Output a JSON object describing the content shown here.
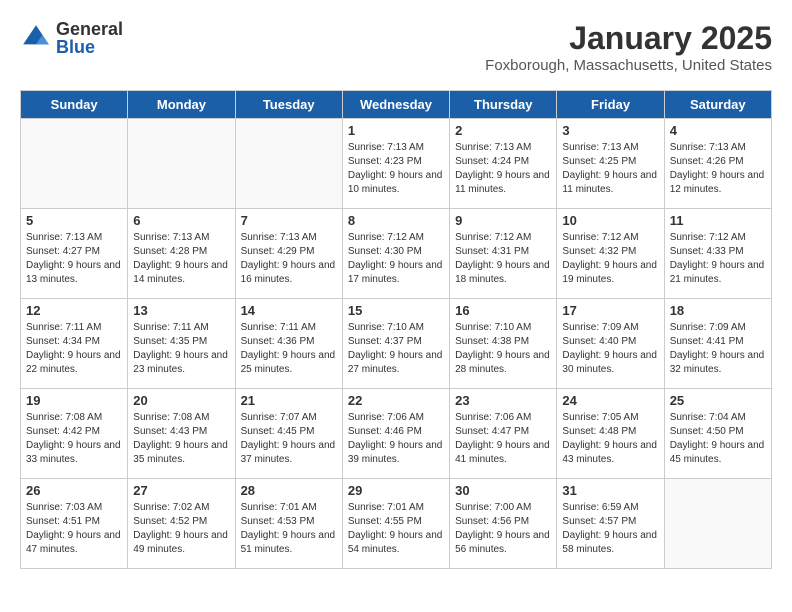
{
  "header": {
    "logo_general": "General",
    "logo_blue": "Blue",
    "month_title": "January 2025",
    "location": "Foxborough, Massachusetts, United States"
  },
  "weekdays": [
    "Sunday",
    "Monday",
    "Tuesday",
    "Wednesday",
    "Thursday",
    "Friday",
    "Saturday"
  ],
  "weeks": [
    [
      {
        "day": "",
        "sunrise": "",
        "sunset": "",
        "daylight": ""
      },
      {
        "day": "",
        "sunrise": "",
        "sunset": "",
        "daylight": ""
      },
      {
        "day": "",
        "sunrise": "",
        "sunset": "",
        "daylight": ""
      },
      {
        "day": "1",
        "sunrise": "Sunrise: 7:13 AM",
        "sunset": "Sunset: 4:23 PM",
        "daylight": "Daylight: 9 hours and 10 minutes."
      },
      {
        "day": "2",
        "sunrise": "Sunrise: 7:13 AM",
        "sunset": "Sunset: 4:24 PM",
        "daylight": "Daylight: 9 hours and 11 minutes."
      },
      {
        "day": "3",
        "sunrise": "Sunrise: 7:13 AM",
        "sunset": "Sunset: 4:25 PM",
        "daylight": "Daylight: 9 hours and 11 minutes."
      },
      {
        "day": "4",
        "sunrise": "Sunrise: 7:13 AM",
        "sunset": "Sunset: 4:26 PM",
        "daylight": "Daylight: 9 hours and 12 minutes."
      }
    ],
    [
      {
        "day": "5",
        "sunrise": "Sunrise: 7:13 AM",
        "sunset": "Sunset: 4:27 PM",
        "daylight": "Daylight: 9 hours and 13 minutes."
      },
      {
        "day": "6",
        "sunrise": "Sunrise: 7:13 AM",
        "sunset": "Sunset: 4:28 PM",
        "daylight": "Daylight: 9 hours and 14 minutes."
      },
      {
        "day": "7",
        "sunrise": "Sunrise: 7:13 AM",
        "sunset": "Sunset: 4:29 PM",
        "daylight": "Daylight: 9 hours and 16 minutes."
      },
      {
        "day": "8",
        "sunrise": "Sunrise: 7:12 AM",
        "sunset": "Sunset: 4:30 PM",
        "daylight": "Daylight: 9 hours and 17 minutes."
      },
      {
        "day": "9",
        "sunrise": "Sunrise: 7:12 AM",
        "sunset": "Sunset: 4:31 PM",
        "daylight": "Daylight: 9 hours and 18 minutes."
      },
      {
        "day": "10",
        "sunrise": "Sunrise: 7:12 AM",
        "sunset": "Sunset: 4:32 PM",
        "daylight": "Daylight: 9 hours and 19 minutes."
      },
      {
        "day": "11",
        "sunrise": "Sunrise: 7:12 AM",
        "sunset": "Sunset: 4:33 PM",
        "daylight": "Daylight: 9 hours and 21 minutes."
      }
    ],
    [
      {
        "day": "12",
        "sunrise": "Sunrise: 7:11 AM",
        "sunset": "Sunset: 4:34 PM",
        "daylight": "Daylight: 9 hours and 22 minutes."
      },
      {
        "day": "13",
        "sunrise": "Sunrise: 7:11 AM",
        "sunset": "Sunset: 4:35 PM",
        "daylight": "Daylight: 9 hours and 23 minutes."
      },
      {
        "day": "14",
        "sunrise": "Sunrise: 7:11 AM",
        "sunset": "Sunset: 4:36 PM",
        "daylight": "Daylight: 9 hours and 25 minutes."
      },
      {
        "day": "15",
        "sunrise": "Sunrise: 7:10 AM",
        "sunset": "Sunset: 4:37 PM",
        "daylight": "Daylight: 9 hours and 27 minutes."
      },
      {
        "day": "16",
        "sunrise": "Sunrise: 7:10 AM",
        "sunset": "Sunset: 4:38 PM",
        "daylight": "Daylight: 9 hours and 28 minutes."
      },
      {
        "day": "17",
        "sunrise": "Sunrise: 7:09 AM",
        "sunset": "Sunset: 4:40 PM",
        "daylight": "Daylight: 9 hours and 30 minutes."
      },
      {
        "day": "18",
        "sunrise": "Sunrise: 7:09 AM",
        "sunset": "Sunset: 4:41 PM",
        "daylight": "Daylight: 9 hours and 32 minutes."
      }
    ],
    [
      {
        "day": "19",
        "sunrise": "Sunrise: 7:08 AM",
        "sunset": "Sunset: 4:42 PM",
        "daylight": "Daylight: 9 hours and 33 minutes."
      },
      {
        "day": "20",
        "sunrise": "Sunrise: 7:08 AM",
        "sunset": "Sunset: 4:43 PM",
        "daylight": "Daylight: 9 hours and 35 minutes."
      },
      {
        "day": "21",
        "sunrise": "Sunrise: 7:07 AM",
        "sunset": "Sunset: 4:45 PM",
        "daylight": "Daylight: 9 hours and 37 minutes."
      },
      {
        "day": "22",
        "sunrise": "Sunrise: 7:06 AM",
        "sunset": "Sunset: 4:46 PM",
        "daylight": "Daylight: 9 hours and 39 minutes."
      },
      {
        "day": "23",
        "sunrise": "Sunrise: 7:06 AM",
        "sunset": "Sunset: 4:47 PM",
        "daylight": "Daylight: 9 hours and 41 minutes."
      },
      {
        "day": "24",
        "sunrise": "Sunrise: 7:05 AM",
        "sunset": "Sunset: 4:48 PM",
        "daylight": "Daylight: 9 hours and 43 minutes."
      },
      {
        "day": "25",
        "sunrise": "Sunrise: 7:04 AM",
        "sunset": "Sunset: 4:50 PM",
        "daylight": "Daylight: 9 hours and 45 minutes."
      }
    ],
    [
      {
        "day": "26",
        "sunrise": "Sunrise: 7:03 AM",
        "sunset": "Sunset: 4:51 PM",
        "daylight": "Daylight: 9 hours and 47 minutes."
      },
      {
        "day": "27",
        "sunrise": "Sunrise: 7:02 AM",
        "sunset": "Sunset: 4:52 PM",
        "daylight": "Daylight: 9 hours and 49 minutes."
      },
      {
        "day": "28",
        "sunrise": "Sunrise: 7:01 AM",
        "sunset": "Sunset: 4:53 PM",
        "daylight": "Daylight: 9 hours and 51 minutes."
      },
      {
        "day": "29",
        "sunrise": "Sunrise: 7:01 AM",
        "sunset": "Sunset: 4:55 PM",
        "daylight": "Daylight: 9 hours and 54 minutes."
      },
      {
        "day": "30",
        "sunrise": "Sunrise: 7:00 AM",
        "sunset": "Sunset: 4:56 PM",
        "daylight": "Daylight: 9 hours and 56 minutes."
      },
      {
        "day": "31",
        "sunrise": "Sunrise: 6:59 AM",
        "sunset": "Sunset: 4:57 PM",
        "daylight": "Daylight: 9 hours and 58 minutes."
      },
      {
        "day": "",
        "sunrise": "",
        "sunset": "",
        "daylight": ""
      }
    ]
  ]
}
